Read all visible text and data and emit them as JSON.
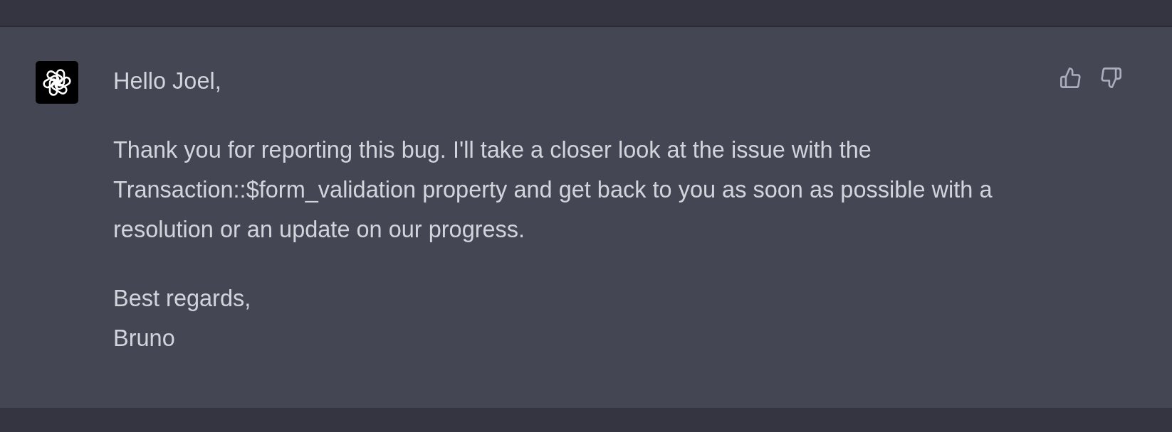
{
  "message": {
    "paragraphs": [
      "Hello Joel,",
      "Thank you for reporting this bug. I'll take a closer look at the issue with the Transaction::$form_validation property and get back to you as soon as possible with a resolution or an update on our progress.",
      "Best regards,\nBruno"
    ]
  }
}
